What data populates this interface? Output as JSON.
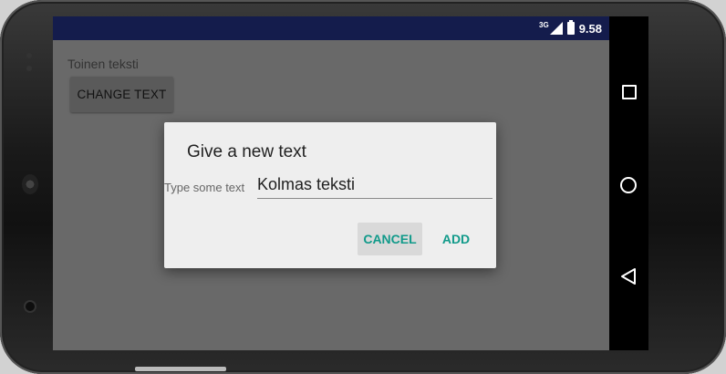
{
  "status_bar": {
    "network": "3G",
    "time": "9.58"
  },
  "app": {
    "label": "Toinen teksti",
    "change_button": "CHANGE TEXT"
  },
  "dialog": {
    "title": "Give a new text",
    "field_label": "Type some text",
    "field_value": "Kolmas teksti",
    "cancel_label": "CANCEL",
    "add_label": "ADD"
  },
  "colors": {
    "status_bar": "#141c4c",
    "accent": "#119a8a",
    "scrim": "#696969"
  },
  "icons": {
    "signal": "cellular-signal-icon",
    "battery": "battery-icon",
    "recents": "recents-icon",
    "home": "home-icon",
    "back": "back-icon"
  }
}
